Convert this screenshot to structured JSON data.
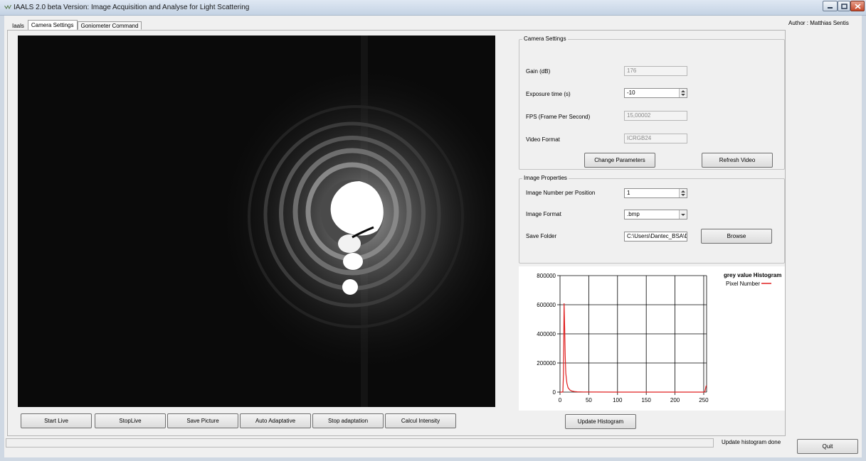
{
  "window": {
    "title": "IAALS 2.0 beta Version: Image Acquisition and Analyse for Light Scattering",
    "controls": [
      "minimize",
      "maximize",
      "close"
    ]
  },
  "tabs": [
    {
      "label": "Iaals",
      "active": false
    },
    {
      "label": "Camera Settings",
      "active": true
    },
    {
      "label": "Goniometer Command",
      "active": false
    }
  ],
  "author": "Author : Matthias Sentis",
  "video_buttons": {
    "start_live": "Start Live",
    "stop_live": "StopLive",
    "save_picture": "Save Picture",
    "auto_adaptative": "Auto Adaptative",
    "stop_adaptation": "Stop adaptation",
    "calcul_intensity": "Calcul Intensity"
  },
  "camera_settings": {
    "title": "Camera Settings",
    "gain_label": "Gain (dB)",
    "gain_value": "176",
    "exposure_label": "Exposure time (s)",
    "exposure_value": "-10",
    "fps_label": "FPS (Frame Per Second)",
    "fps_value": "15,00002",
    "video_format_label": "Video Format",
    "video_format_value": "ICRGB24",
    "change_parameters": "Change Parameters",
    "refresh_video": "Refresh Video"
  },
  "image_properties": {
    "title": "Image Properties",
    "image_number_label": "Image Number per Position",
    "image_number_value": "1",
    "image_format_label": "Image Format",
    "image_format_value": ".bmp",
    "save_folder_label": "Save Folder",
    "save_folder_value": "C:\\Users\\Dantec_BSA\\Des",
    "browse": "Browse"
  },
  "update_histogram": "Update Histogram",
  "status_text": "Update histogram done",
  "quit": "Quit",
  "chart_data": {
    "type": "line",
    "title": "grey value Histogram",
    "legend_placement": "top-right",
    "grid": true,
    "xlim": [
      0,
      255
    ],
    "ylim": [
      0,
      800000
    ],
    "x_ticks": [
      0,
      50,
      100,
      150,
      200,
      250
    ],
    "y_ticks": [
      0,
      200000,
      400000,
      600000,
      800000
    ],
    "x_tick_labels": [
      "0",
      "50",
      "100",
      "150",
      "200",
      "250"
    ],
    "y_tick_labels": [
      "0",
      "200000",
      "400000",
      "600000",
      "800000"
    ],
    "series": [
      {
        "name": "Pixel Number",
        "color": "#e02020",
        "x": [
          0,
          3,
          5,
          6,
          7,
          8,
          9,
          10,
          12,
          14,
          17,
          20,
          25,
          30,
          40,
          60,
          100,
          150,
          200,
          240,
          250,
          252,
          254,
          255
        ],
        "y": [
          0,
          0,
          2000,
          120000,
          610000,
          450000,
          250000,
          130000,
          60000,
          30000,
          15000,
          8000,
          4000,
          2000,
          800,
          300,
          100,
          50,
          30,
          20,
          50,
          3000,
          40000,
          45000
        ]
      }
    ]
  }
}
